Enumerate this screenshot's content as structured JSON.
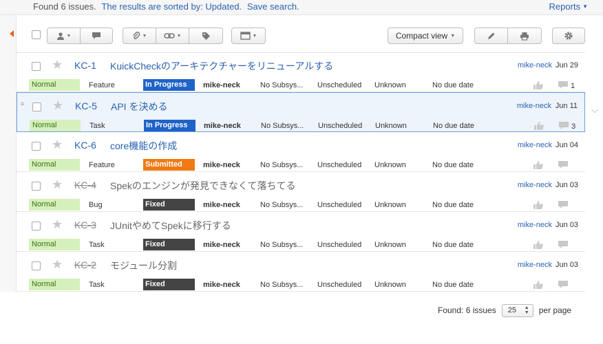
{
  "header": {
    "found_text": "Found 6 issues.",
    "sorted_text": "The results are sorted by: Updated.",
    "save_search": "Save search.",
    "reports": "Reports"
  },
  "toolbar": {
    "compact_view": "Compact view"
  },
  "issues": [
    {
      "key": "KC-1",
      "title": "KuickCheckのアーキテクチャーをリニューアルする",
      "reporter": "mike-neck",
      "date": "Jun 29",
      "priority": "Normal",
      "type": "Feature",
      "status": "In Progress",
      "assignee": "mike-neck",
      "subsystem": "No Subsys...",
      "fix_version": "Unscheduled",
      "estimation": "Unknown",
      "due": "No due date",
      "comments": "1",
      "resolved": false,
      "selected": false
    },
    {
      "key": "KC-5",
      "title": "API を決める",
      "reporter": "mike-neck",
      "date": "Jun 11",
      "priority": "Normal",
      "type": "Task",
      "status": "In Progress",
      "assignee": "mike-neck",
      "subsystem": "No Subsys...",
      "fix_version": "Unscheduled",
      "estimation": "Unknown",
      "due": "No due date",
      "comments": "3",
      "resolved": false,
      "selected": true
    },
    {
      "key": "KC-6",
      "title": "core機能の作成",
      "reporter": "mike-neck",
      "date": "Jun 04",
      "priority": "Normal",
      "type": "Feature",
      "status": "Submitted",
      "assignee": "mike-neck",
      "subsystem": "No Subsys...",
      "fix_version": "Unscheduled",
      "estimation": "Unknown",
      "due": "No due date",
      "comments": "",
      "resolved": false,
      "selected": false
    },
    {
      "key": "KC-4",
      "title": "Spekのエンジンが発見できなくて落ちてる",
      "reporter": "mike-neck",
      "date": "Jun 03",
      "priority": "Normal",
      "type": "Bug",
      "status": "Fixed",
      "assignee": "mike-neck",
      "subsystem": "No Subsys...",
      "fix_version": "Unscheduled",
      "estimation": "Unknown",
      "due": "No due date",
      "comments": "",
      "resolved": true,
      "selected": false
    },
    {
      "key": "KC-3",
      "title": "JUnitやめてSpekに移行する",
      "reporter": "mike-neck",
      "date": "Jun 03",
      "priority": "Normal",
      "type": "Task",
      "status": "Fixed",
      "assignee": "mike-neck",
      "subsystem": "No Subsys...",
      "fix_version": "Unscheduled",
      "estimation": "Unknown",
      "due": "No due date",
      "comments": "",
      "resolved": true,
      "selected": false
    },
    {
      "key": "KC-2",
      "title": "モジュール分割",
      "reporter": "mike-neck",
      "date": "Jun 03",
      "priority": "Normal",
      "type": "Task",
      "status": "Fixed",
      "assignee": "mike-neck",
      "subsystem": "No Subsys...",
      "fix_version": "Unscheduled",
      "estimation": "Unknown",
      "due": "No due date",
      "comments": "",
      "resolved": true,
      "selected": false
    }
  ],
  "footer": {
    "found": "Found: 6 issues",
    "per_page_value": "25",
    "per_page_label": "per page"
  },
  "colors": {
    "link": "#2a62b0",
    "in_progress": "#1f63c9",
    "submitted": "#f07a14",
    "fixed": "#444444",
    "priority_normal": "#d6f0bb"
  }
}
